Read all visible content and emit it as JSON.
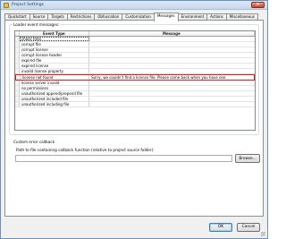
{
  "window": {
    "title": "Project Settings",
    "close_label": "✕"
  },
  "tabs": [
    {
      "label": "Quickstart",
      "active": false
    },
    {
      "label": "Source",
      "active": false
    },
    {
      "label": "Targets",
      "active": false
    },
    {
      "label": "Restrictions",
      "active": false
    },
    {
      "label": "Obfuscation",
      "active": false
    },
    {
      "label": "Customization",
      "active": false
    },
    {
      "label": "Messages",
      "active": true
    },
    {
      "label": "Environment",
      "active": false
    },
    {
      "label": "Actions",
      "active": false
    },
    {
      "label": "Miscellaneous",
      "active": false
    }
  ],
  "loader_messages": {
    "group_label": "Loader event messages:",
    "columns": {
      "event_type": "Event Type",
      "message": "Message"
    },
    "rows": [
      {
        "event": "check time",
        "message": ""
      },
      {
        "event": "corrupt file",
        "message": ""
      },
      {
        "event": "corrupt license",
        "message": ""
      },
      {
        "event": "corrupt license header",
        "message": ""
      },
      {
        "event": "expired file",
        "message": ""
      },
      {
        "event": "expired license",
        "message": ""
      },
      {
        "event": "invalid license property",
        "message": ""
      },
      {
        "event": "license not found",
        "message": "Sorry, we couldn't find a license file. Please come back when you have one"
      },
      {
        "event": "license server invalid",
        "message": ""
      },
      {
        "event": "no permissions",
        "message": ""
      },
      {
        "event": "unauthorized append/prepend file",
        "message": ""
      },
      {
        "event": "unauthorized included file",
        "message": ""
      },
      {
        "event": "unauthorized including file",
        "message": ""
      }
    ]
  },
  "custom_error": {
    "label": "Custom error callback",
    "path_label": "Path to file containing callback function (relative to project source folder):",
    "path_value": "",
    "browse_label": "Browse..."
  },
  "footer": {
    "ok_label": "OK",
    "cancel_label": "Cancel"
  },
  "colors": {
    "highlight_border": "#e0191d",
    "titlebar": "#c4d7ee"
  }
}
